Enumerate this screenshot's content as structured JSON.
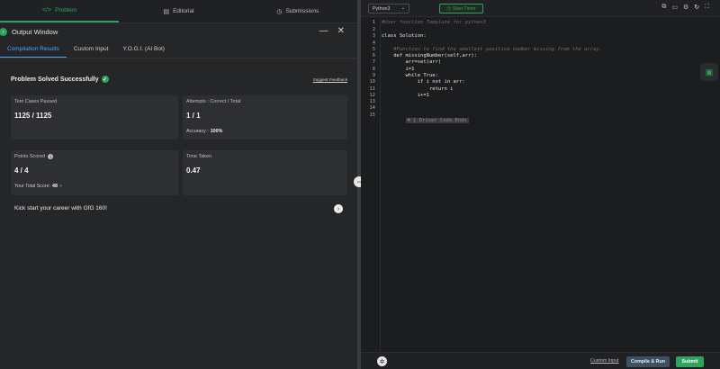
{
  "top_tabs": {
    "problem": {
      "label": "Problem",
      "icon": "code-icon"
    },
    "editorial": {
      "label": "Editorial",
      "icon": "document-icon"
    },
    "submissions": {
      "label": "Submissions",
      "icon": "clock-icon"
    }
  },
  "output_window": {
    "title": "Output Window",
    "tabs": [
      "Compilation Results",
      "Custom Input",
      "Y.O.G.I. (AI Bot)"
    ]
  },
  "result": {
    "status": "Problem Solved Successfully",
    "suggest_feedback": "Suggest Feedback",
    "test_cases_label": "Test Cases Passed",
    "test_cases_value": "1125 / 1125",
    "attempts_label": "Attempts : Correct / Total",
    "attempts_value": "1 / 1",
    "accuracy_label": "Accuracy :",
    "accuracy_value": "100%",
    "points_label": "Points Scored",
    "points_value": "4 / 4",
    "total_score_label": "Your Total Score:",
    "total_score_value": "48",
    "time_label": "Time Taken",
    "time_value": "0.47"
  },
  "kickstart": "Kick start your career with GfG 160!",
  "editor": {
    "language": "Python3",
    "timer_label": "Start Timer",
    "line_numbers": [
      "1",
      "2",
      "3",
      "4",
      "5",
      "6",
      "7",
      "8",
      "9",
      "10",
      "11",
      "12",
      "13",
      "14",
      "15"
    ],
    "lines": [
      "#User function Template for python3",
      "",
      "class Solution:",
      "",
      "    #Function to find the smallest positive number missing from the array.",
      "    def missingNumber(self,arr):",
      "        arr=set(arr)",
      "        i=1",
      "        while True:",
      "            if i not in arr:",
      "                return i",
      "            i+=1",
      "",
      "",
      ""
    ],
    "folded_text": "# } Driver Code Ends",
    "footer": {
      "custom_input": "Custom Input",
      "compile_run": "Compile & Run",
      "submit": "Submit"
    }
  },
  "colors": {
    "accent_green": "#2fa35b",
    "accent_blue": "#4aa3ff",
    "compile_bg": "#3c4f63"
  }
}
